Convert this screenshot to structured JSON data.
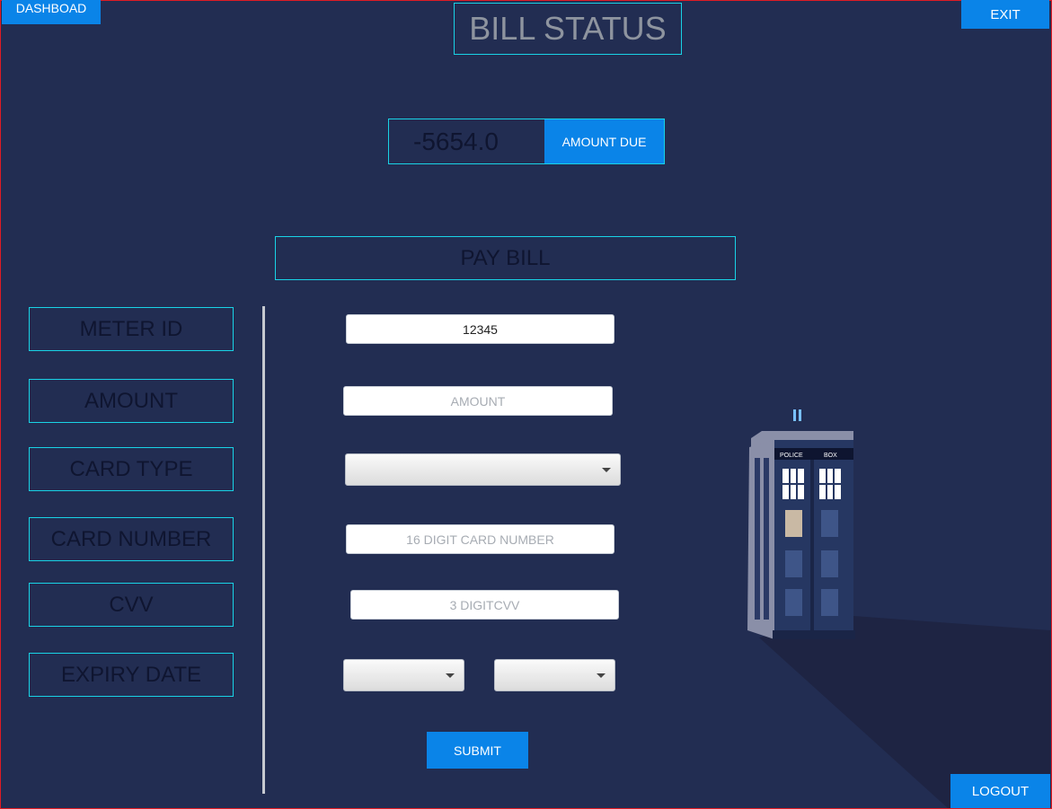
{
  "header": {
    "title": "BILL STATUS",
    "dashboard_label": "DASHBOAD",
    "exit_label": "EXIT"
  },
  "amount_due": {
    "value": "-5654.0",
    "label": "AMOUNT DUE"
  },
  "pay_bill": {
    "title": "PAY BILL"
  },
  "form": {
    "labels": {
      "meter_id": "METER ID",
      "amount": "AMOUNT",
      "card_type": "CARD TYPE",
      "card_number": "CARD NUMBER",
      "cvv": "CVV",
      "expiry_date": "EXPIRY DATE"
    },
    "meter_id_value": "12345",
    "amount_placeholder": "AMOUNT",
    "card_number_placeholder": "16 DIGIT CARD NUMBER",
    "cvv_placeholder": "3 DIGITCVV",
    "card_type_selected": "",
    "expiry_month_selected": "",
    "expiry_year_selected": "",
    "submit_label": "SUBMIT"
  },
  "footer": {
    "logout_label": "LOGOUT"
  },
  "illustration": {
    "icon": "police-box-icon",
    "sign_left": "POLICE",
    "sign_right": "BOX"
  },
  "colors": {
    "background": "#222d52",
    "accent_button": "#0a84e8",
    "outline": "#19d3e6",
    "window_border": "#e01b24"
  }
}
